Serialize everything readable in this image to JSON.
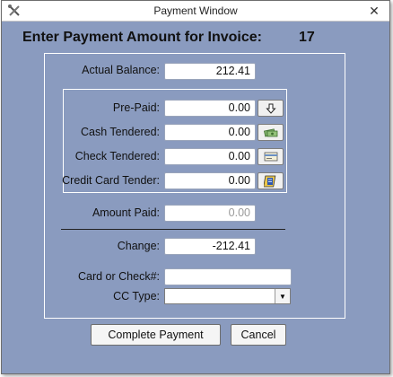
{
  "window": {
    "title": "Payment Window"
  },
  "heading": {
    "text": "Enter Payment Amount for Invoice:",
    "invoice_number": "17"
  },
  "balance": {
    "label": "Actual Balance:",
    "value": "212.41"
  },
  "tenders": [
    {
      "label": "Pre-Paid:",
      "value": "0.00",
      "icon": "arrow-down-icon"
    },
    {
      "label": "Cash Tendered:",
      "value": "0.00",
      "icon": "cash-icon"
    },
    {
      "label": "Check Tendered:",
      "value": "0.00",
      "icon": "check-icon"
    },
    {
      "label": "Credit Card Tender:",
      "value": "0.00",
      "icon": "credit-card-icon"
    }
  ],
  "amount_paid": {
    "label": "Amount Paid:",
    "value": "0.00"
  },
  "change": {
    "label": "Change:",
    "value": "-212.41"
  },
  "card_check": {
    "label": "Card or Check#:",
    "value": ""
  },
  "cc_type": {
    "label": "CC Type:",
    "value": ""
  },
  "buttons": {
    "complete": "Complete Payment",
    "cancel": "Cancel"
  },
  "colors": {
    "window_bg": "#8a9bbf",
    "field_bg": "#ffffff"
  }
}
